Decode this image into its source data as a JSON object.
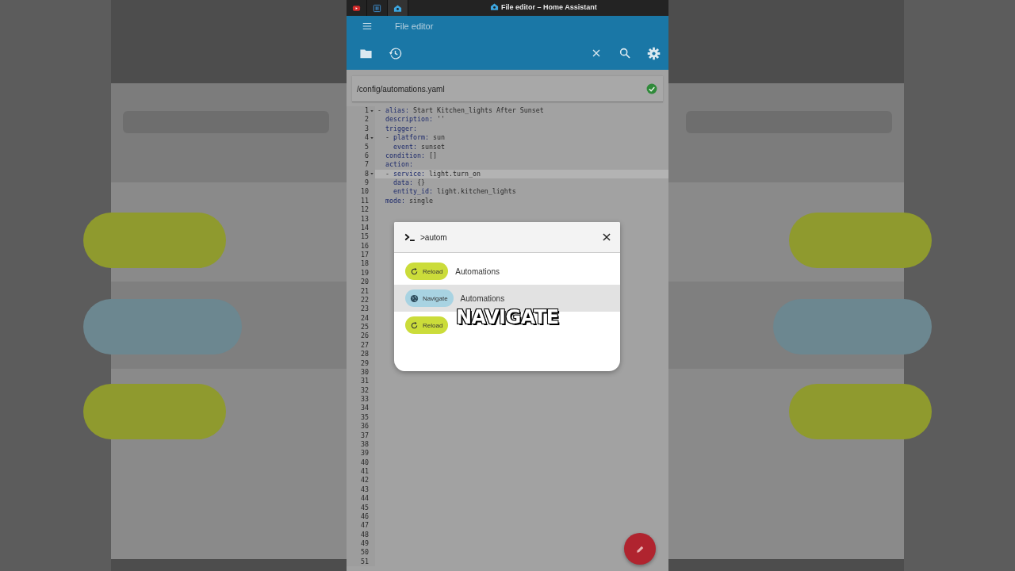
{
  "browser": {
    "tabs": [
      {
        "kind": "video",
        "selected": false
      },
      {
        "kind": "editor",
        "selected": false
      },
      {
        "kind": "home",
        "selected": true
      }
    ],
    "title": "File editor – Home Assistant"
  },
  "app": {
    "title": "File editor",
    "path": "/config/automations.yaml",
    "saved": true
  },
  "editor": {
    "lines": [
      {
        "number": "1",
        "text": "- alias: Start Kitchen_lights After Sunset",
        "fold": true,
        "highlighted": false
      },
      {
        "number": "2",
        "text": "  description: ''",
        "fold": false,
        "highlighted": false
      },
      {
        "number": "3",
        "text": "  trigger:",
        "fold": false,
        "highlighted": false
      },
      {
        "number": "4",
        "text": "  - platform: sun",
        "fold": true,
        "highlighted": false
      },
      {
        "number": "5",
        "text": "    event: sunset",
        "fold": false,
        "highlighted": false
      },
      {
        "number": "6",
        "text": "  condition: []",
        "fold": false,
        "highlighted": false
      },
      {
        "number": "7",
        "text": "  action:",
        "fold": false,
        "highlighted": false
      },
      {
        "number": "8",
        "text": "  - service: light.turn_on",
        "fold": true,
        "highlighted": true
      },
      {
        "number": "9",
        "text": "    data: {}",
        "fold": false,
        "highlighted": false
      },
      {
        "number": "10",
        "text": "    entity_id: light.kitchen_lights",
        "fold": false,
        "highlighted": false
      },
      {
        "number": "11",
        "text": "  mode: single",
        "fold": false,
        "highlighted": false
      },
      {
        "number": "12"
      },
      {
        "number": "13"
      },
      {
        "number": "14"
      },
      {
        "number": "15"
      },
      {
        "number": "16"
      },
      {
        "number": "17"
      },
      {
        "number": "18"
      },
      {
        "number": "19"
      },
      {
        "number": "20"
      },
      {
        "number": "21"
      },
      {
        "number": "22"
      },
      {
        "number": "23"
      },
      {
        "number": "24"
      },
      {
        "number": "25"
      },
      {
        "number": "26"
      },
      {
        "number": "27"
      },
      {
        "number": "28"
      },
      {
        "number": "29"
      },
      {
        "number": "30"
      },
      {
        "number": "31"
      },
      {
        "number": "32"
      },
      {
        "number": "33"
      },
      {
        "number": "34"
      },
      {
        "number": "35"
      },
      {
        "number": "36"
      },
      {
        "number": "37"
      },
      {
        "number": "38"
      },
      {
        "number": "39"
      },
      {
        "number": "40"
      },
      {
        "number": "41"
      },
      {
        "number": "42"
      },
      {
        "number": "43"
      },
      {
        "number": "44"
      },
      {
        "number": "45"
      },
      {
        "number": "46"
      },
      {
        "number": "47"
      },
      {
        "number": "48"
      },
      {
        "number": "49"
      },
      {
        "number": "50"
      },
      {
        "number": "51"
      }
    ]
  },
  "command_dialog": {
    "query": ">autom",
    "items": [
      {
        "kind": "reload",
        "chip": "Reload",
        "label": "Automations",
        "selected": false
      },
      {
        "kind": "navigate",
        "chip": "Navigate",
        "label": "Automations",
        "selected": true
      },
      {
        "kind": "reload",
        "chip": "Reload",
        "selected": false
      }
    ]
  },
  "caption": "NAVIGATE"
}
